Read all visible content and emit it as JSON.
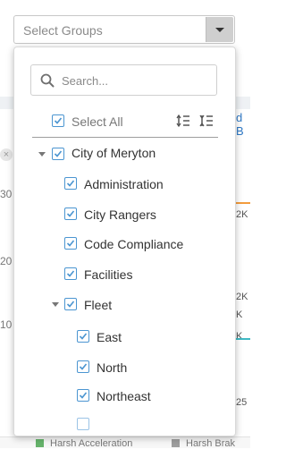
{
  "background": {
    "y_labels": [
      "30",
      "20",
      "10"
    ],
    "right_labels": [
      "d B",
      "2K",
      "2K",
      "K",
      "K",
      "25"
    ],
    "legend": [
      "Harsh Acceleration",
      "Harsh Brak"
    ],
    "colors": {
      "orange": "#f39c3d",
      "teal": "#3fb9c4",
      "green": "#66b36b",
      "gray": "#9e9e9e"
    }
  },
  "select": {
    "placeholder": "Select Groups",
    "button_icon": "caret-down-icon"
  },
  "dropdown": {
    "search_placeholder": "Search...",
    "select_all_label": "Select All",
    "select_all_checked": true,
    "tools": [
      "expand-all-icon",
      "collapse-all-icon"
    ],
    "tree": [
      {
        "label": "City of Meryton",
        "checked": true,
        "expanded": true,
        "children": [
          {
            "label": "Administration",
            "checked": true
          },
          {
            "label": "City Rangers",
            "checked": true
          },
          {
            "label": "Code Compliance",
            "checked": true
          },
          {
            "label": "Facilities",
            "checked": true
          },
          {
            "label": "Fleet",
            "checked": true,
            "expanded": true,
            "children": [
              {
                "label": "East",
                "checked": true
              },
              {
                "label": "North",
                "checked": true
              },
              {
                "label": "Northeast",
                "checked": true
              }
            ]
          }
        ]
      }
    ]
  },
  "accent_color": "#4b95d1"
}
